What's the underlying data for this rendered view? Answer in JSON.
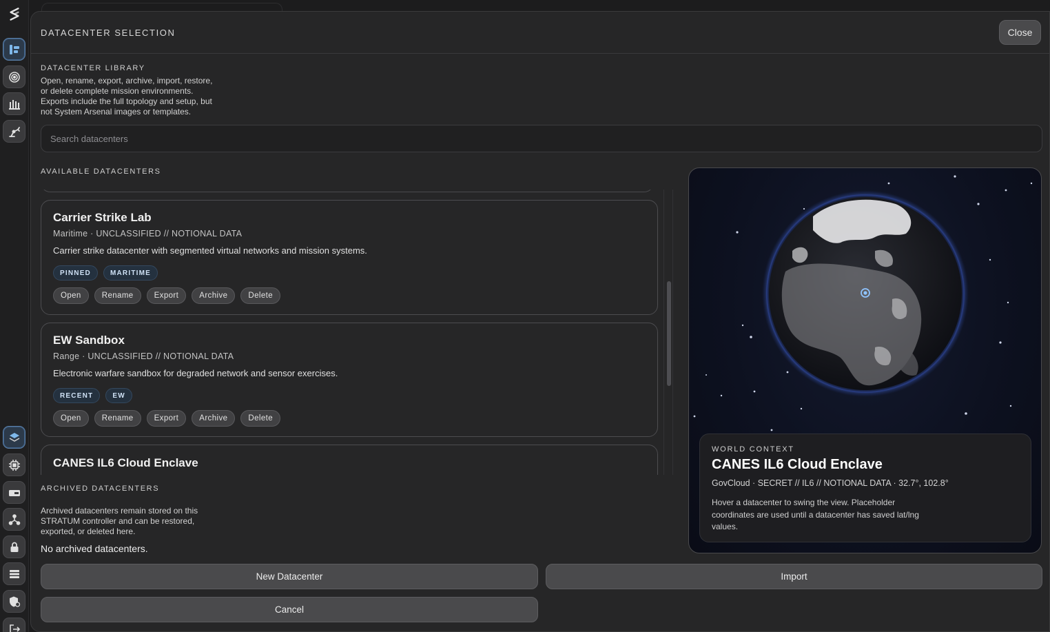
{
  "modal": {
    "title": "DATACENTER SELECTION",
    "close_label": "Close"
  },
  "library": {
    "label": "DATACENTER LIBRARY",
    "description_lines": [
      "Open, rename, export, archive, import, restore,",
      "or delete complete mission environments.",
      "Exports include the full topology and setup, but",
      "not System Arsenal images or templates."
    ]
  },
  "search": {
    "placeholder": "Search datacenters",
    "value": ""
  },
  "available": {
    "label": "AVAILABLE DATACENTERS",
    "cards": [
      {
        "title": "Carrier Strike Lab",
        "meta": "Maritime · UNCLASSIFIED // NOTIONAL DATA",
        "description": "Carrier strike datacenter with segmented virtual networks and mission systems.",
        "tags": [
          "PINNED",
          "MARITIME"
        ],
        "actions": [
          "Open",
          "Rename",
          "Export",
          "Archive",
          "Delete"
        ]
      },
      {
        "title": "EW Sandbox",
        "meta": "Range · UNCLASSIFIED // NOTIONAL DATA",
        "description": "Electronic warfare sandbox for degraded network and sensor exercises.",
        "tags": [
          "RECENT",
          "EW"
        ],
        "actions": [
          "Open",
          "Rename",
          "Export",
          "Archive",
          "Delete"
        ]
      },
      {
        "title": "CANES IL6 Cloud Enclave"
      }
    ]
  },
  "archived": {
    "label": "ARCHIVED DATACENTERS",
    "description_lines": [
      "Archived datacenters remain stored on this",
      "STRATUM controller and can be restored,",
      "exported, or deleted here."
    ],
    "empty_text": "No archived datacenters."
  },
  "world": {
    "label": "WORLD CONTEXT",
    "title": "CANES IL6 Cloud Enclave",
    "meta": "GovCloud · SECRET // IL6 // NOTIONAL DATA · 32.7°, 102.8°",
    "description": "Hover a datacenter to swing the view. Placeholder coordinates are used until a datacenter has saved lat/lng values."
  },
  "buttons": {
    "new_label": "New Datacenter",
    "import_label": "Import",
    "cancel_label": "Cancel"
  },
  "rail": {
    "top_icons": [
      "topology-icon",
      "target-icon",
      "arsenal-icon",
      "robot-arm-icon"
    ],
    "bottom_icons": [
      "layers-icon",
      "chip-icon",
      "storage-icon",
      "network-icon",
      "lock-icon",
      "list-icon",
      "shield-icon",
      "logout-icon"
    ]
  },
  "colors": {
    "accent": "#5a7ea6",
    "tag_bg": "#24313f",
    "marker": "#8fc4ff"
  }
}
